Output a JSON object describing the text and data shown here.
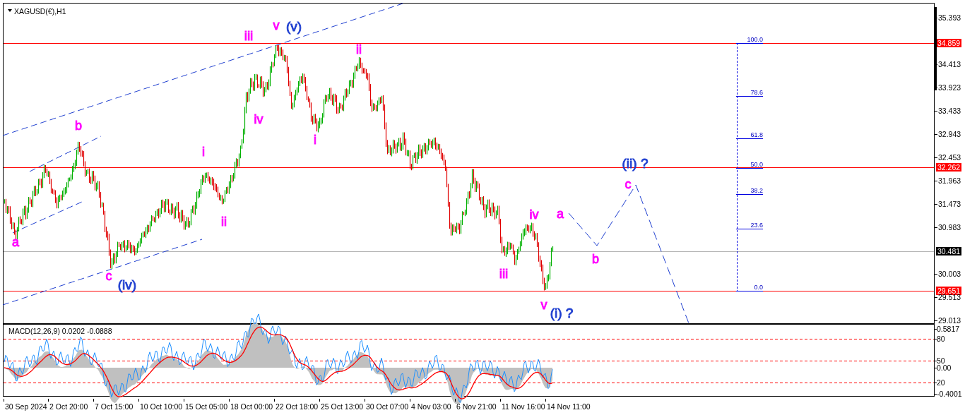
{
  "chart": {
    "title": "XAGUSD(€),H1",
    "price_ticks": [
      "35.393",
      "34.413",
      "33.923",
      "33.433",
      "32.943",
      "32.453",
      "31.963",
      "31.473",
      "30.983",
      "30.003",
      "29.513",
      "29.013"
    ],
    "price_tags": [
      {
        "text": "34.859",
        "kind": "level"
      },
      {
        "text": "32.262",
        "kind": "level"
      },
      {
        "text": "30.481",
        "kind": "bid"
      },
      {
        "text": "29.651",
        "kind": "level"
      }
    ],
    "wave_labels": [
      {
        "text": "a",
        "color": "#ff00ff"
      },
      {
        "text": "b",
        "color": "#ff00ff"
      },
      {
        "text": "c",
        "color": "#ff00ff"
      },
      {
        "text": "(iv)",
        "color": "#1f3fd0"
      },
      {
        "text": "i",
        "color": "#ff00ff"
      },
      {
        "text": "ii",
        "color": "#ff00ff"
      },
      {
        "text": "iii",
        "color": "#ff00ff"
      },
      {
        "text": "iv",
        "color": "#ff00ff"
      },
      {
        "text": "v",
        "color": "#ff00ff"
      },
      {
        "text": "(v)",
        "color": "#1f3fd0"
      },
      {
        "text": "i",
        "color": "#ff00ff"
      },
      {
        "text": "ii",
        "color": "#ff00ff"
      },
      {
        "text": "iii",
        "color": "#ff00ff"
      },
      {
        "text": "iv",
        "color": "#ff00ff"
      },
      {
        "text": "v",
        "color": "#ff00ff"
      },
      {
        "text": "(i) ?",
        "color": "#1f3fd0"
      },
      {
        "text": "a",
        "color": "#ff00ff"
      },
      {
        "text": "b",
        "color": "#ff00ff"
      },
      {
        "text": "c",
        "color": "#ff00ff"
      },
      {
        "text": "(ii) ?",
        "color": "#1f3fd0"
      }
    ],
    "fibonacci_levels": [
      "100.0",
      "78.6",
      "61.8",
      "50.0",
      "38.2",
      "23.6",
      "0.0"
    ]
  },
  "macd": {
    "title": "MACD(12,26,9) 0.0202 -0.0888",
    "axis_labels": [
      "0.5817",
      "80",
      "50",
      "0.00",
      "20",
      "-0.4001"
    ]
  },
  "time_axis": [
    "30 Sep 2024",
    "2 Oct 20:00",
    "7 Oct 15:00",
    "10 Oct 10:00",
    "15 Oct 05:00",
    "18 Oct 00:00",
    "22 Oct 18:00",
    "25 Oct 13:00",
    "30 Oct 07:00",
    "4 Nov 03:00",
    "6 Nov 21:00",
    "11 Nov 16:00",
    "14 Nov 11:00"
  ]
}
